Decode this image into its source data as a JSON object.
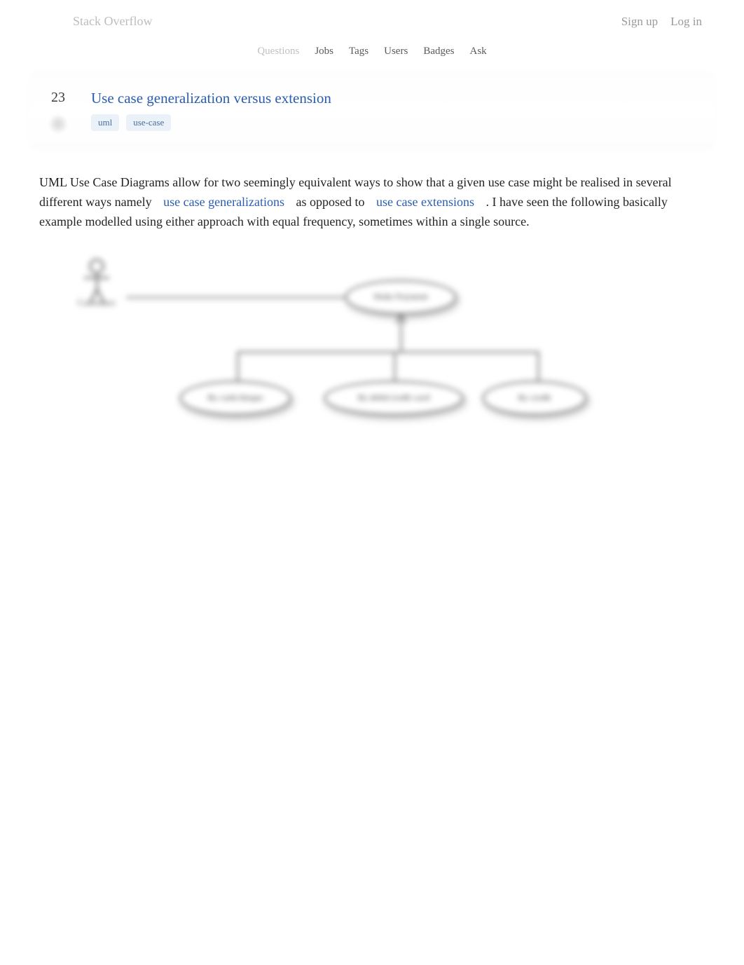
{
  "header": {
    "site_name": "Stack Overflow",
    "sign_up": "Sign up",
    "log_in": "Log in"
  },
  "nav": {
    "questions": "Questions",
    "jobs": "Jobs",
    "tags": "Tags",
    "users": "Users",
    "badges": "Badges",
    "ask": "Ask"
  },
  "question": {
    "votes": "23",
    "title": "Use case generalization versus extension",
    "tags": [
      "uml",
      "use-case"
    ]
  },
  "post": {
    "part1": "UML Use Case Diagrams allow for two seemingly equivalent ways to show that a given use case might be realised in several different ways namely ",
    "link1": "use case generalizations",
    "part2": " as opposed to ",
    "link2": "use case extensions",
    "part3": ". I have seen the following basically example modelled using either approach with equal frequency, sometimes within a single source."
  },
  "diagram": {
    "actor": "Customer",
    "main": "Make Payment",
    "c1": "By cash/cheque",
    "c2": "By debit/credit card",
    "c3": "By credit"
  }
}
